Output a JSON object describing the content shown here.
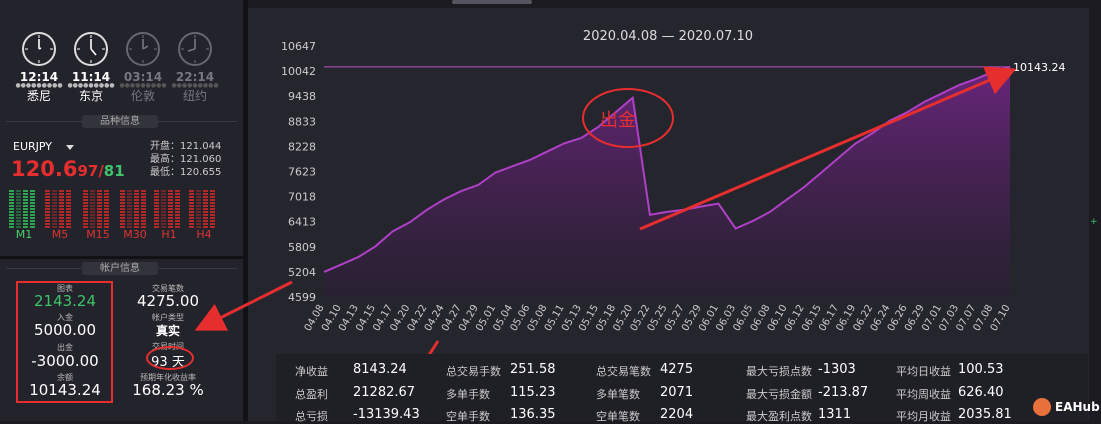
{
  "clocks": [
    {
      "time": "12:14",
      "city": "悉尼",
      "active": true
    },
    {
      "time": "11:14",
      "city": "东京",
      "active": true
    },
    {
      "time": "03:14",
      "city": "伦敦",
      "active": false
    },
    {
      "time": "22:14",
      "city": "纽约",
      "active": false
    }
  ],
  "sections": {
    "product": "品种信息",
    "account": "帐户信息"
  },
  "symbol": {
    "name": "EURJPY",
    "price_main": "120.6",
    "price_bid": "97",
    "separator": "/",
    "price_ask": "81",
    "open_label": "开盘：121.044",
    "high_label": "最高：121.060",
    "low_label": "最低：120.655"
  },
  "timeframes": [
    "M1",
    "M5",
    "M15",
    "M30",
    "H1",
    "H4"
  ],
  "account": {
    "equity_label": "图表",
    "equity": "2143.24",
    "deposit_label": "入金",
    "deposit": "5000.00",
    "withdraw_label": "出金",
    "withdraw": "-3000.00",
    "balance_label": "余额",
    "balance": "10143.24",
    "trades_label": "交易笔数",
    "trades": "4275.00",
    "acct_type_label": "帐户类型",
    "acct_type": "真实",
    "trade_time_label": "交易时间",
    "trade_time": "93 天",
    "annual_label": "预期年化收益率",
    "annual": "168.23 %"
  },
  "chart_data": {
    "type": "area",
    "title": "2020.04.08 — 2020.07.10",
    "ylim": [
      4599,
      10647
    ],
    "yticks": [
      "10647",
      "10042",
      "9438",
      "8833",
      "8228",
      "7623",
      "7018",
      "6413",
      "5809",
      "5204",
      "4599"
    ],
    "x": [
      "04.08",
      "04.10",
      "04.13",
      "04.15",
      "04.17",
      "04.20",
      "04.22",
      "04.24",
      "04.27",
      "04.29",
      "05.01",
      "05.04",
      "05.06",
      "05.08",
      "05.11",
      "05.13",
      "05.15",
      "05.18",
      "05.20",
      "05.22",
      "05.25",
      "05.27",
      "05.29",
      "06.01",
      "06.03",
      "06.05",
      "06.08",
      "06.10",
      "06.12",
      "06.15",
      "06.17",
      "06.19",
      "06.22",
      "06.24",
      "06.26",
      "06.29",
      "07.01",
      "07.03",
      "07.07",
      "07.08",
      "07.10"
    ],
    "values": [
      5204,
      5380,
      5560,
      5820,
      6180,
      6400,
      6700,
      6950,
      7150,
      7300,
      7600,
      7750,
      7900,
      8100,
      8300,
      8430,
      8700,
      9050,
      9400,
      6580,
      6650,
      6700,
      6780,
      6850,
      6250,
      6430,
      6650,
      6950,
      7250,
      7600,
      7950,
      8300,
      8550,
      8850,
      9050,
      9300,
      9500,
      9700,
      9850,
      10020,
      10143
    ],
    "end_label": "10143.24",
    "grid": false,
    "annotation": "出金"
  },
  "stats": [
    [
      {
        "label": "净收益",
        "value": "8143.24"
      },
      {
        "label": "总盈利",
        "value": "21282.67"
      },
      {
        "label": "总亏损",
        "value": "-13139.43"
      }
    ],
    [
      {
        "label": "总交易手数",
        "value": "251.58"
      },
      {
        "label": "多单手数",
        "value": "115.23"
      },
      {
        "label": "空单手数",
        "value": "136.35"
      }
    ],
    [
      {
        "label": "总交易笔数",
        "value": "4275"
      },
      {
        "label": "多单笔数",
        "value": "2071"
      },
      {
        "label": "空单笔数",
        "value": "2204"
      }
    ],
    [
      {
        "label": "最大亏损点数",
        "value": "-1303"
      },
      {
        "label": "最大亏损金额",
        "value": "-213.87"
      },
      {
        "label": "最大盈利点数",
        "value": "1311"
      }
    ],
    [
      {
        "label": "平均日收益",
        "value": "100.53"
      },
      {
        "label": "平均周收益",
        "value": "626.40"
      },
      {
        "label": "平均月收益",
        "value": "2035.81"
      }
    ]
  ],
  "watermark": "EAHub",
  "colors": {
    "accent_red": "#e62e2e",
    "green": "#3ec46a",
    "purple_line": "#b040c8",
    "purple_fill": "#5a1f66"
  }
}
